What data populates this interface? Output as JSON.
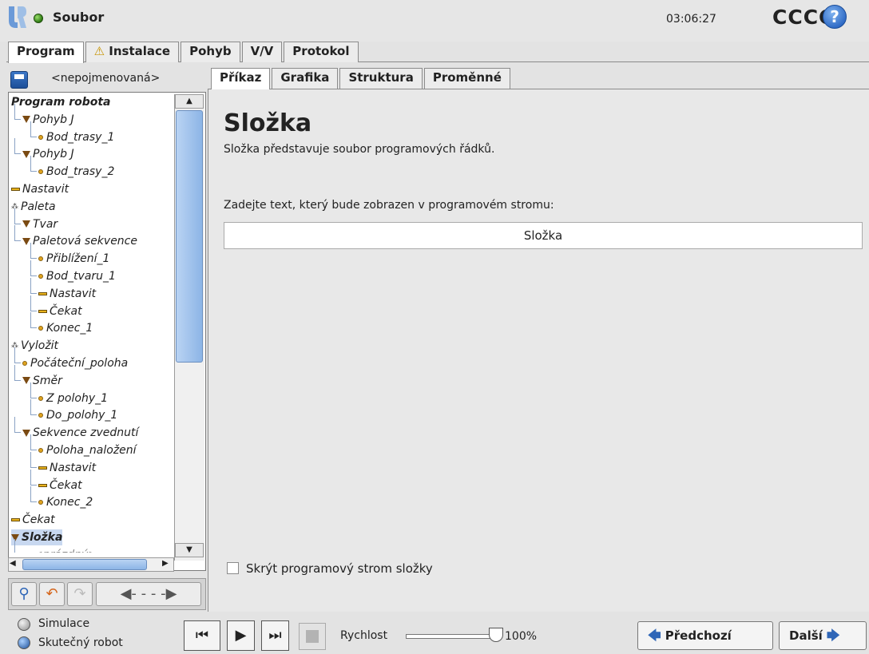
{
  "topbar": {
    "file_label": "Soubor",
    "clock": "03:06:27",
    "robot_name": "CCCC",
    "help": "?"
  },
  "main_tabs": [
    "Program",
    "Instalace",
    "Pohyb",
    "V/V",
    "Protokol"
  ],
  "program": {
    "name": "<nepojmenovaná>"
  },
  "tree": [
    {
      "label": "Program robota",
      "icon": "none",
      "style": "bold"
    },
    {
      "label": "Pohyb J",
      "icon": "triangle"
    },
    {
      "label": "Bod_trasy_1",
      "icon": "dot"
    },
    {
      "label": "Pohyb J",
      "icon": "triangle"
    },
    {
      "label": "Bod_trasy_2",
      "icon": "dot"
    },
    {
      "label": "Nastavit",
      "icon": "bar"
    },
    {
      "label": "Paleta",
      "icon": "pallet"
    },
    {
      "label": "Tvar",
      "icon": "triangle"
    },
    {
      "label": "Paletová sekvence",
      "icon": "triangle"
    },
    {
      "label": "Přiblížení_1",
      "icon": "dot"
    },
    {
      "label": "Bod_tvaru_1",
      "icon": "dot"
    },
    {
      "label": "Nastavit",
      "icon": "bar"
    },
    {
      "label": "Čekat",
      "icon": "bar"
    },
    {
      "label": "Konec_1",
      "icon": "dot"
    },
    {
      "label": "Vyložit",
      "icon": "pallet"
    },
    {
      "label": "Počáteční_poloha",
      "icon": "dot"
    },
    {
      "label": "Směr",
      "icon": "triangle"
    },
    {
      "label": "Z polohy_1",
      "icon": "dot"
    },
    {
      "label": "Do_polohy_1",
      "icon": "dot"
    },
    {
      "label": "Sekvence zvednutí",
      "icon": "triangle"
    },
    {
      "label": "Poloha_naložení",
      "icon": "dot"
    },
    {
      "label": "Nastavit",
      "icon": "bar"
    },
    {
      "label": "Čekat",
      "icon": "bar"
    },
    {
      "label": "Konec_2",
      "icon": "dot"
    },
    {
      "label": "Čekat",
      "icon": "bar"
    },
    {
      "label": "Složka",
      "icon": "triangle",
      "style": "selected"
    },
    {
      "label": "<prázdný>",
      "icon": "bar",
      "style": "muted"
    }
  ],
  "sub_tabs": [
    "Příkaz",
    "Grafika",
    "Struktura",
    "Proměnné"
  ],
  "content": {
    "title": "Složka",
    "description": "Složka představuje soubor programových řádků.",
    "prompt": "Zadejte text, který bude zobrazen v programovém stromu:",
    "field_value": "Složka",
    "checkbox_label": "Skrýt programový strom složky",
    "checkbox_checked": false
  },
  "bottom": {
    "simulation": "Simulace",
    "real_robot": "Skutečný robot",
    "selected_mode": "real_robot",
    "speed_label": "Rychlost",
    "speed_value": "100%",
    "speed_fraction": 1.0,
    "prev_label": "Předchozí",
    "next_label": "Další"
  },
  "colors": {
    "accent_blue": "#2f66b7",
    "status_green": "#3c9a1a",
    "warning_yellow": "#e8b21c"
  }
}
